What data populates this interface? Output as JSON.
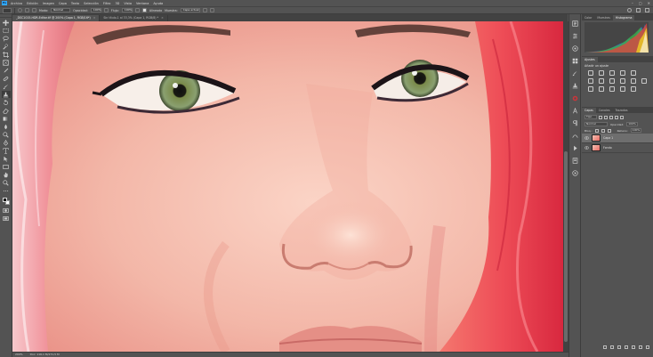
{
  "menubar": {
    "logo": "Ps",
    "items": [
      "Archivo",
      "Edición",
      "Imagen",
      "Capa",
      "Texto",
      "Selección",
      "Filtro",
      "3D",
      "Vista",
      "Ventana",
      "Ayuda"
    ],
    "window_controls": [
      "–",
      "▢",
      "✕"
    ]
  },
  "options": {
    "mode_label": "Modo:",
    "mode_value": "Normal",
    "opacity_label": "Opacidad:",
    "opacity_value": "100%",
    "flow_label": "Flujo:",
    "flow_value": "100%",
    "aligned_label": "Alineado",
    "sample_label": "Muestra:",
    "sample_value": "Capa actual"
  },
  "tabs": [
    {
      "label": "_DSC1015-HDR-Editar.tif @ 200% (Capa 1, RGB/16*)",
      "close": "×"
    },
    {
      "label": "Sin título-1 al 33,3% (Capa 1, RGB/8) *",
      "close": "×"
    }
  ],
  "status": {
    "zoom": "200%",
    "doc": "Doc: 116,1 M/171,5 M"
  },
  "panels": {
    "top_tabs": [
      "Color",
      "Muestras",
      "Histograma"
    ],
    "adjust_tab": "Ajustes",
    "adjust_title": "Añadir un ajuste",
    "layer_tabs": [
      "Capas",
      "Canales",
      "Trazados"
    ],
    "kind": "Tipo",
    "blend": "Normal",
    "opacity_label": "Opacidad:",
    "opacity_value": "100%",
    "lock_label": "Bloq.:",
    "fill_label": "Relleno:",
    "fill_value": "100%",
    "layers": [
      {
        "name": "Capa 1",
        "selected": true
      },
      {
        "name": "Fondo",
        "selected": false
      }
    ]
  },
  "colors": {
    "accent": "#31a8ff",
    "ui_bg": "#535353",
    "tab_bg": "#424242",
    "skin": "#f2b3a6",
    "hair": "#f05a5f"
  }
}
